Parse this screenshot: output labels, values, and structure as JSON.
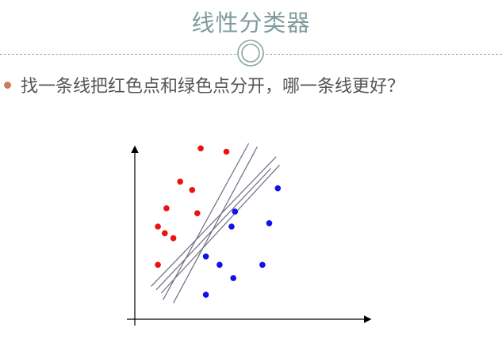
{
  "slide": {
    "title": "线性分类器",
    "bullet": "找一条线把红色点和绿色点分开，哪一条线更好？"
  },
  "colors": {
    "title": "#7f9c9c",
    "bullet_dot": "#c8805a",
    "bullet_text": "#555555",
    "red_points": "#ee1111",
    "blue_points": "#1111ee",
    "lines": "#6b6f80",
    "axes": "#000000"
  },
  "chart_data": {
    "type": "scatter",
    "xlim": [
      0,
      100
    ],
    "ylim": [
      0,
      100
    ],
    "axes": "arrows, no ticks, no labels",
    "grid": false,
    "series": [
      {
        "color": "#ee1111",
        "points": [
          [
            32,
            97
          ],
          [
            47,
            95
          ],
          [
            20,
            77
          ],
          [
            27,
            72
          ],
          [
            12,
            61
          ],
          [
            30,
            58
          ],
          [
            7,
            50
          ],
          [
            11,
            46
          ],
          [
            16,
            43
          ],
          [
            7,
            27
          ]
        ]
      },
      {
        "color": "#1111ee",
        "points": [
          [
            77,
            73
          ],
          [
            52,
            59
          ],
          [
            50,
            50
          ],
          [
            72,
            52
          ],
          [
            35,
            32
          ],
          [
            43,
            27
          ],
          [
            51,
            19
          ],
          [
            68,
            27
          ],
          [
            35,
            9
          ]
        ]
      }
    ],
    "lines": [
      [
        [
          10,
          6
        ],
        [
          60,
          100
        ]
      ],
      [
        [
          16,
          4
        ],
        [
          65,
          98
        ]
      ],
      [
        [
          3,
          14
        ],
        [
          76,
          92
        ]
      ],
      [
        [
          9,
          10
        ],
        [
          78,
          87
        ]
      ],
      [
        [
          6,
          12
        ],
        [
          73,
          85
        ]
      ]
    ]
  }
}
